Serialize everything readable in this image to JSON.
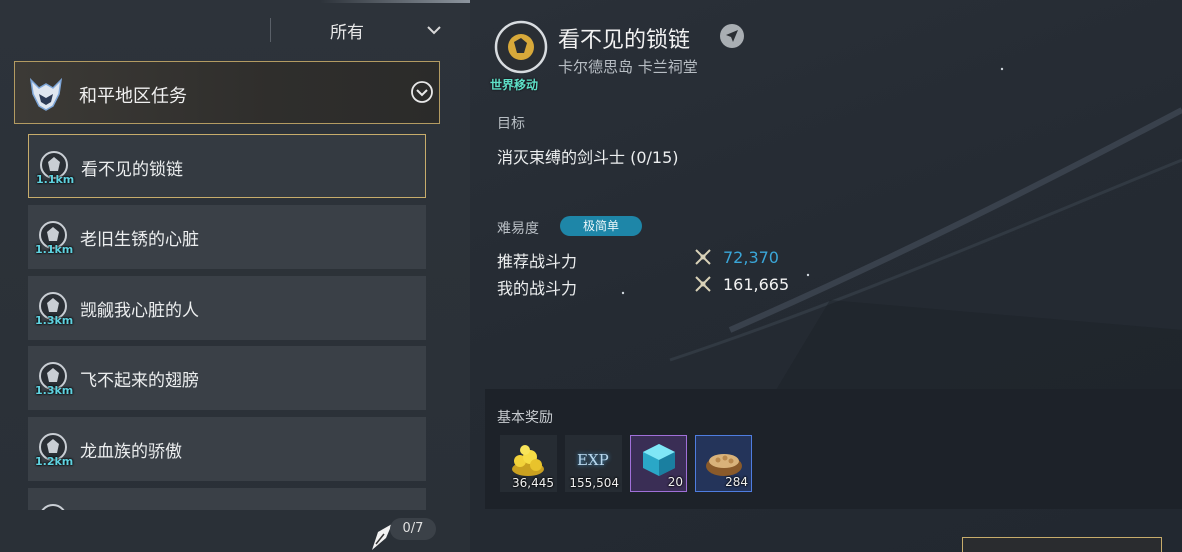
{
  "filter": {
    "selected": "所有"
  },
  "category": {
    "title": "和平地区任务"
  },
  "quests": [
    {
      "title": "看不见的锁链",
      "distance": "1.1km"
    },
    {
      "title": "老旧生锈的心脏",
      "distance": "1.1km"
    },
    {
      "title": "觊觎我心脏的人",
      "distance": "1.3km"
    },
    {
      "title": "飞不起来的翅膀",
      "distance": "1.3km"
    },
    {
      "title": "龙血族的骄傲",
      "distance": "1.2km"
    }
  ],
  "progress": "0/7",
  "detail": {
    "type_label": "世界移动",
    "title": "看不见的锁链",
    "location": "卡尔德思岛 卡兰祠堂",
    "objective_label": "目标",
    "objective": "消灭束缚的剑斗士  (0/15)",
    "difficulty_label": "难易度",
    "difficulty": "极简单",
    "recommended_power_label": "推荐战斗力",
    "recommended_power": "72,370",
    "my_power_label": "我的战斗力",
    "my_power": "161,665",
    "rewards_label": "基本奖励",
    "rewards": [
      {
        "icon": "gold-coins-icon",
        "count": "36,445"
      },
      {
        "icon": "exp-icon",
        "label": "EXP",
        "count": "155,504"
      },
      {
        "icon": "crystal-cube-icon",
        "count": "20"
      },
      {
        "icon": "seed-basket-icon",
        "count": "284"
      }
    ]
  },
  "colors": {
    "accent_gold": "#c7ac6b",
    "recommended_power": "#3aa6d8",
    "distance": "#5fd2e0",
    "difficulty_badge": "#1e86a8",
    "quest_type_label": "#5fe0c8"
  }
}
